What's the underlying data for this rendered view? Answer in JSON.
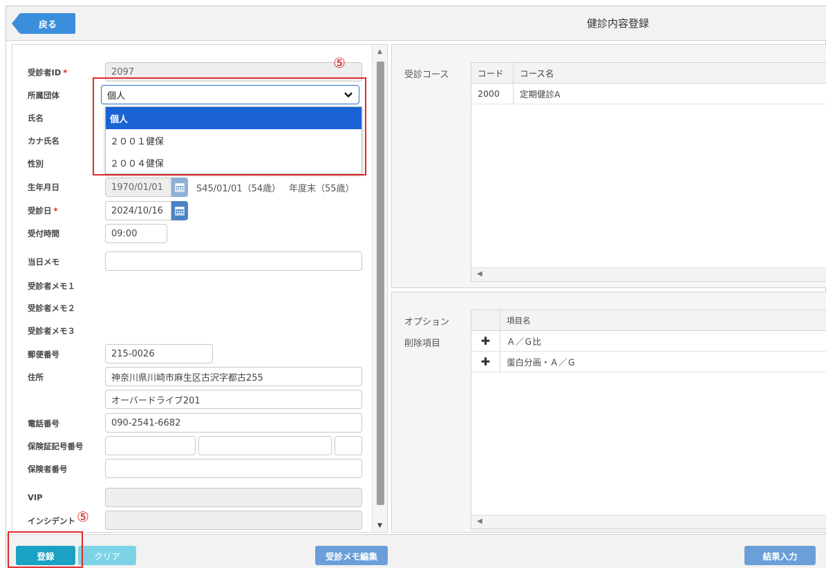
{
  "header": {
    "back_label": "戻る",
    "title": "健診内容登録"
  },
  "marker_label": "⑤",
  "form": {
    "patient_id": {
      "label": "受診者ID",
      "value": "2097"
    },
    "org": {
      "label": "所属団体",
      "value": "個人",
      "options": [
        "個人",
        "２００１健保",
        "２００４健保"
      ]
    },
    "name": {
      "label": "氏名"
    },
    "kana": {
      "label": "カナ氏名"
    },
    "gender": {
      "label": "性別"
    },
    "birth": {
      "label": "生年月日",
      "value": "1970/01/01",
      "wareki": "S45/01/01（54歳）",
      "fiscal_age": "年度末（55歳）"
    },
    "exam_date": {
      "label": "受診日",
      "value": "2024/10/16"
    },
    "reception_time": {
      "label": "受付時間",
      "value": "09:00"
    },
    "day_memo": {
      "label": "当日メモ",
      "value": ""
    },
    "memo1": {
      "label": "受診者メモ１"
    },
    "memo2": {
      "label": "受診者メモ２"
    },
    "memo3": {
      "label": "受診者メモ３"
    },
    "postal": {
      "label": "郵便番号",
      "value": "215-0026"
    },
    "address": {
      "label": "住所",
      "line1": "神奈川県川崎市麻生区古沢字都古255",
      "line2": "オーバードライブ201"
    },
    "phone": {
      "label": "電話番号",
      "value": "090-2541-6682"
    },
    "insurance_symbol": {
      "label": "保険証記号番号"
    },
    "insurer_no": {
      "label": "保険者番号"
    },
    "vip": {
      "label": "VIP"
    },
    "incident": {
      "label": "インシデント"
    },
    "required_mark": "*"
  },
  "course": {
    "label": "受診コース",
    "headers": [
      "コード",
      "コース名"
    ],
    "rows": [
      {
        "code": "2000",
        "name": "定期健診A"
      }
    ]
  },
  "options": {
    "label_option": "オプション",
    "label_delete": "削除項目",
    "header": "項目名",
    "rows": [
      {
        "name": "Ａ／Ｇ比"
      },
      {
        "name": "蛋白分画・Ａ／Ｇ"
      }
    ]
  },
  "footer": {
    "register": "登録",
    "clear": "クリア",
    "memo_edit": "受診メモ編集",
    "result_input": "結果入力"
  },
  "colors": {
    "primary": "#3b8edb",
    "teal": "#1aa1c4",
    "highlight": "#e02828",
    "selected": "#1a63d5"
  }
}
